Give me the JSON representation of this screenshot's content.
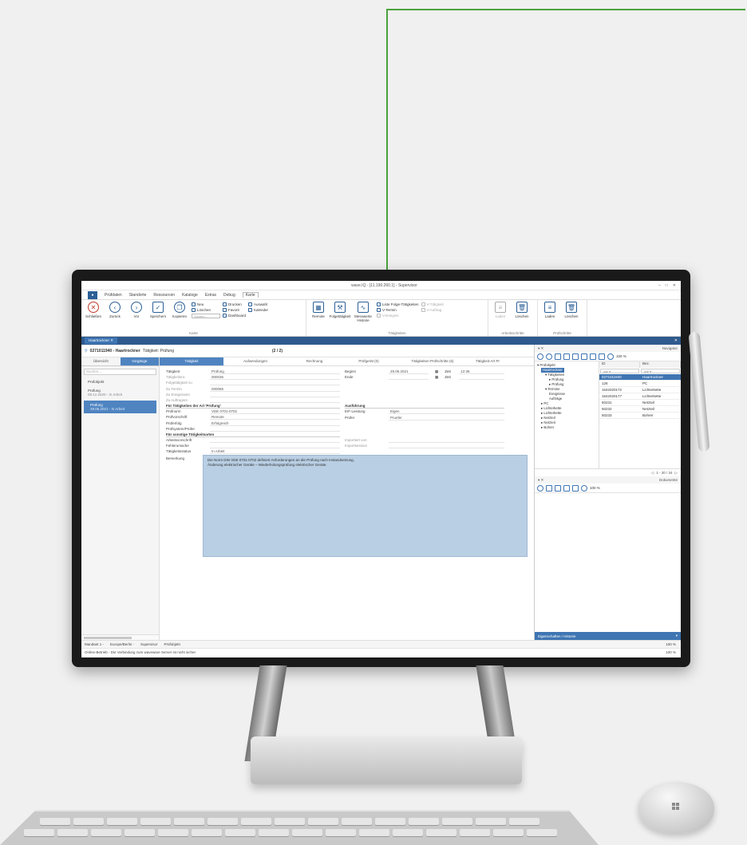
{
  "window": {
    "title": "wave.IQ - [11.190.260.1] - Supervisor",
    "controls": [
      "–",
      "□",
      "✕"
    ]
  },
  "menu": {
    "app_button": "●",
    "items": [
      "Prüfdaten",
      "Standorte",
      "Ressourcen",
      "Kataloge",
      "Extras",
      "Debug",
      "Karte"
    ],
    "active": "Karte"
  },
  "ribbon": {
    "karte": {
      "label": "Karte",
      "big": [
        "Schließen",
        "Zurück",
        "Vor",
        "Speichern",
        "Kopieren"
      ],
      "small1": [
        "Neu",
        "Löschen"
      ],
      "search_placeholder": "Suchen...",
      "small2": [
        "Drucken",
        "Favorit",
        "Dashboard"
      ],
      "small3": [
        "Auswahl",
        "Kalender"
      ]
    },
    "taetigkeiten": {
      "label": "Tätigkeiten",
      "big": [
        "Remote",
        "Folgetätigkeit",
        "Messwerte Historie"
      ],
      "small1": [
        "Liste Folge-Tätigkeiten",
        "V-Termin",
        "V-Ereignis"
      ],
      "small2": [
        "V-Tätigkeit",
        "V-Auftrag"
      ]
    },
    "arbeitsschritte": {
      "label": "Arbeitsschritte",
      "big": [
        "Laden",
        "Löschen"
      ]
    },
    "pruefschritte": {
      "label": "Prüfschritte",
      "big": [
        "Laden",
        "Löschen"
      ]
    }
  },
  "doc_tab": {
    "label": "Haartrockner",
    "close": "✕"
  },
  "header": {
    "id": "0271011940 - Haartrockner",
    "subtitle": "Tätigkeit: Prüfung",
    "counter": "(2 / 2)"
  },
  "left_nav": {
    "tabs": [
      "Übersicht",
      "Vorgänge"
    ],
    "search_placeholder": "Suchen...",
    "items": [
      {
        "title": "Prüfobjekt",
        "sub": ""
      },
      {
        "title": "Prüfung",
        "sub": "08.12.2020 - In Arbeit"
      },
      {
        "title": "Prüfung",
        "sub": "29.06.2021 - In Arbeit"
      }
    ]
  },
  "detail_tabs": [
    "Tätigkeit",
    "Aufwendungen",
    "Rechnung",
    "Prüfgerät (0)",
    "Tätigkeiten-Prüfschritte (6)",
    "Tätigkeit-Art Pr"
  ],
  "form": {
    "col1": [
      {
        "label": "Tätigkeit",
        "value": "Prüfung",
        "muted": false
      },
      {
        "label": "Tätigkeitsnr.",
        "value": "000036",
        "muted": true
      },
      {
        "label": "Folgetätigkeit zu",
        "value": "",
        "muted": true
      },
      {
        "label": "Zu Termin",
        "value": "000065",
        "muted": true
      },
      {
        "label": "Zu Ereignissen",
        "value": "",
        "muted": true
      },
      {
        "label": "Zu Auftragsnr.",
        "value": "",
        "muted": true
      }
    ],
    "col2": [
      {
        "label": "Beginn",
        "value": "29.06.2021",
        "extra_label": "Zeit",
        "extra_value": "12:36"
      },
      {
        "label": "Ende",
        "value": "",
        "extra_label": "Zeit",
        "extra_value": ""
      }
    ],
    "section_art": "Für Tätigkeiten der Art 'Prüfung'",
    "art_rows": [
      {
        "label": "Prüfnorm",
        "value": "VDE 0701-0702"
      },
      {
        "label": "Prüfvorschrift",
        "value": "Remote"
      },
      {
        "label": "Prüferfolg",
        "value": "Erfolgreich"
      },
      {
        "label": "Prüfsystem/Prüfer",
        "value": ""
      }
    ],
    "section_ausfuehrung": "Ausführung",
    "ausf_rows": [
      {
        "label": "E/F-Leistung",
        "value": "Eigen"
      },
      {
        "label": "Prüfer",
        "value": "Pruefer"
      }
    ],
    "section_sonstige": "Für sonstige Tätigkeitsarten",
    "sonst_rows": [
      {
        "label": "Arbeitsvorschrift",
        "value": ""
      },
      {
        "label": "Fehlerursache",
        "value": ""
      }
    ],
    "import_rows": [
      {
        "label": "Importiert von",
        "value": ""
      },
      {
        "label": "Importsession",
        "value": ""
      }
    ],
    "status_row": {
      "label": "Tätigkeitsstatus",
      "value": "In Arbeit"
    },
    "remark_label": "Bemerkung",
    "remark_lines": [
      "Die Norm DIN VDE 0701-0702 definiert Anforderungen an die Prüfung nach Instandsetzung,",
      "Änderung elektrischer Geräte – Wiederholungsprüfung elektrischer Geräte."
    ]
  },
  "navigator": {
    "title": "Navigator",
    "pin": "▾ ✕",
    "zoom": "100 %",
    "tree": [
      {
        "text": "▾ Prüfobjekt",
        "indent": 0,
        "hl": false
      },
      {
        "text": "Haartrockner",
        "indent": 1,
        "hl": true
      },
      {
        "text": "▾ Tätigkeiten",
        "indent": 2,
        "hl": false
      },
      {
        "text": "▸ Prüfung",
        "indent": 3,
        "hl": false
      },
      {
        "text": "▸ Prüfung",
        "indent": 3,
        "hl": false
      },
      {
        "text": "▾ Termine",
        "indent": 2,
        "hl": false
      },
      {
        "text": "Ereignisse",
        "indent": 3,
        "hl": false
      },
      {
        "text": "Aufträge",
        "indent": 3,
        "hl": false
      },
      {
        "text": "▸ PC",
        "indent": 1,
        "hl": false
      },
      {
        "text": "▸ Lichterkette",
        "indent": 1,
        "hl": false
      },
      {
        "text": "▸ Lichterkette",
        "indent": 1,
        "hl": false
      },
      {
        "text": "▸ Netzteil",
        "indent": 1,
        "hl": false
      },
      {
        "text": "▸ Netzteil",
        "indent": 1,
        "hl": false
      },
      {
        "text": "▸ Bohrer",
        "indent": 1,
        "hl": false
      }
    ],
    "grid_headers": [
      "ID",
      "Bez."
    ],
    "grid_filters": [
      "wie ▾",
      "wie ▾"
    ],
    "grid_rows": [
      {
        "id": "0271011940",
        "bez": "Haartrockner",
        "sel": true
      },
      {
        "id": "126",
        "bez": "PC",
        "sel": false
      },
      {
        "id": "1542020172",
        "bez": "Lichterkette",
        "sel": false
      },
      {
        "id": "1542020177",
        "bez": "Lichterkette",
        "sel": false
      },
      {
        "id": "50231",
        "bez": "Netzteil",
        "sel": false
      },
      {
        "id": "50232",
        "bez": "Netzteil",
        "sel": false
      },
      {
        "id": "50233",
        "bez": "Bohrer",
        "sel": false
      }
    ],
    "pager": "1 - 30 / 34"
  },
  "documents": {
    "title": "Dokumente",
    "pin": "▾ ✕",
    "zoom": "100 %"
  },
  "props_bar": {
    "label": "Eigenschaften / Historie",
    "arrow": "▾"
  },
  "statusbar": {
    "items": [
      "Mandant 1 -",
      "Europe/Berlin -",
      "Supervisor",
      "Prüfobjekt"
    ],
    "zoom": "100 %"
  },
  "msgbar": {
    "text": "Online-Betrieb - Die Verbindung zum waveware Server ist nicht sicher.",
    "zoom": "100 %"
  }
}
